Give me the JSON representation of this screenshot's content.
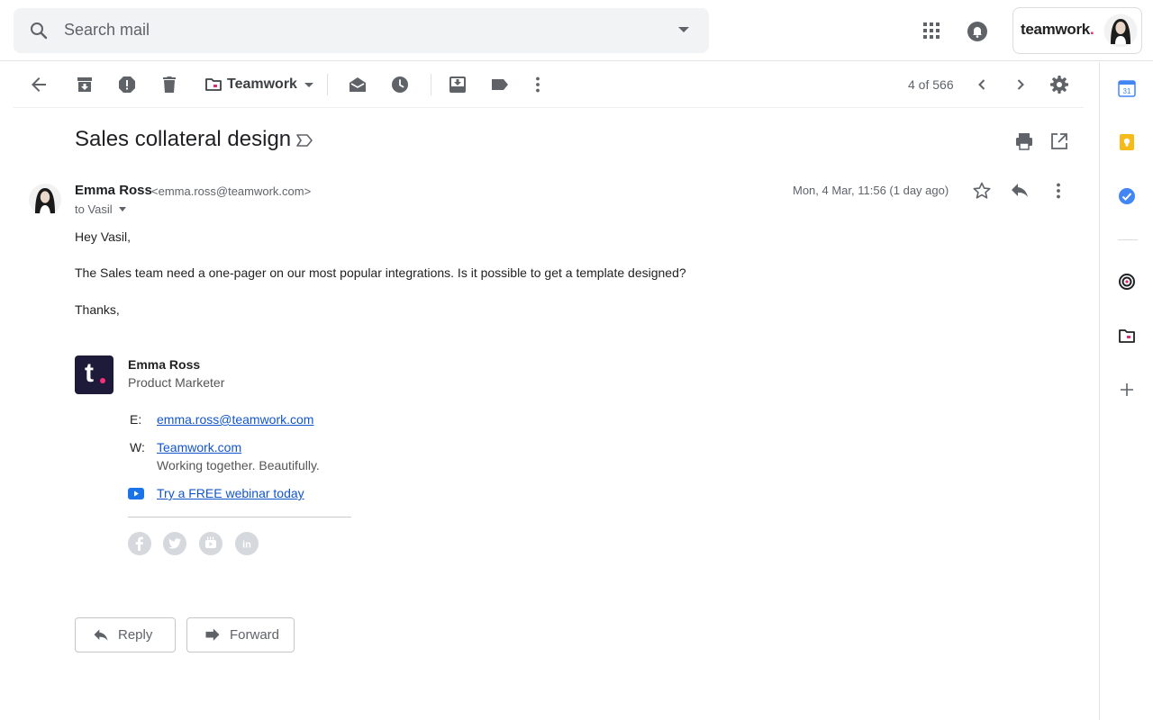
{
  "search": {
    "placeholder": "Search mail"
  },
  "account": {
    "brand": "teamwork",
    "brand_dot": "."
  },
  "toolbar": {
    "folder_label": "Teamwork",
    "pager": "4 of 566"
  },
  "message": {
    "subject": "Sales collateral design",
    "sender_name": "Emma Ross",
    "sender_email": "<emma.ross@teamwork.com>",
    "to_line": "to Vasil",
    "date": "Mon, 4 Mar, 11:56 (1 day ago)",
    "body": [
      "Hey Vasil,",
      "The Sales team need a one-pager on our most popular integrations. Is it possible to get a template designed?",
      "Thanks,"
    ]
  },
  "signature": {
    "logo_letter": "t",
    "name": "Emma Ross",
    "title": "Product Marketer",
    "email_key": "E:",
    "email": "emma.ross@teamwork.com",
    "web_key": "W:",
    "web": "Teamwork.com",
    "tagline": "Working together. Beautifully.",
    "webinar": "Try a FREE webinar today",
    "socials": [
      "facebook-icon",
      "twitter-icon",
      "youtube-icon",
      "linkedin-icon"
    ]
  },
  "actions": {
    "reply": "Reply",
    "forward": "Forward"
  },
  "colors": {
    "link": "#1155cc",
    "brand_pink": "#e6246b",
    "logo_bg": "#1e1b3a",
    "keep_yellow": "#f6bb18",
    "tasks_blue": "#4285f4"
  }
}
